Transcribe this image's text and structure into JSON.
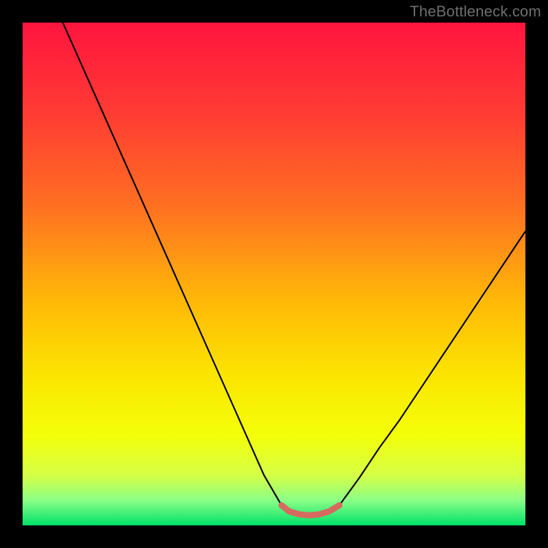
{
  "attribution": "TheBottleneck.com",
  "chart_data": {
    "type": "line",
    "title": "",
    "xlabel": "",
    "ylabel": "",
    "xlim": [
      0,
      100
    ],
    "ylim": [
      0,
      100
    ],
    "grid": false,
    "legend": false,
    "background_gradient_stops": [
      {
        "offset": 0.0,
        "color": "#ff153f"
      },
      {
        "offset": 0.18,
        "color": "#ff3b33"
      },
      {
        "offset": 0.36,
        "color": "#ff6e22"
      },
      {
        "offset": 0.55,
        "color": "#ffb708"
      },
      {
        "offset": 0.7,
        "color": "#fbe400"
      },
      {
        "offset": 0.82,
        "color": "#f4ff09"
      },
      {
        "offset": 0.9,
        "color": "#d6ff45"
      },
      {
        "offset": 0.95,
        "color": "#8bff86"
      },
      {
        "offset": 1.0,
        "color": "#00e06a"
      }
    ],
    "series": [
      {
        "name": "left-branch",
        "color": "#000000",
        "x": [
          8.0,
          12.0,
          16.0,
          20.0,
          24.0,
          28.0,
          32.0,
          36.0,
          40.0,
          44.0,
          48.0,
          51.5
        ],
        "y": [
          100.0,
          91.0,
          82.0,
          73.0,
          64.0,
          55.0,
          46.0,
          37.0,
          28.0,
          19.0,
          10.0,
          4.0
        ]
      },
      {
        "name": "right-branch",
        "color": "#000000",
        "x": [
          63.0,
          67.0,
          71.0,
          75.0,
          79.0,
          83.0,
          87.0,
          91.0,
          95.0,
          99.0,
          100.0
        ],
        "y": [
          4.0,
          9.5,
          15.5,
          21.0,
          27.0,
          33.0,
          39.0,
          45.0,
          51.0,
          57.0,
          58.5
        ]
      },
      {
        "name": "valley-highlight",
        "color": "#d56a60",
        "x": [
          51.5,
          53.0,
          55.0,
          57.0,
          59.0,
          61.0,
          63.0
        ],
        "y": [
          4.0,
          2.8,
          2.2,
          2.0,
          2.2,
          2.8,
          4.0
        ]
      }
    ],
    "annotations": []
  }
}
